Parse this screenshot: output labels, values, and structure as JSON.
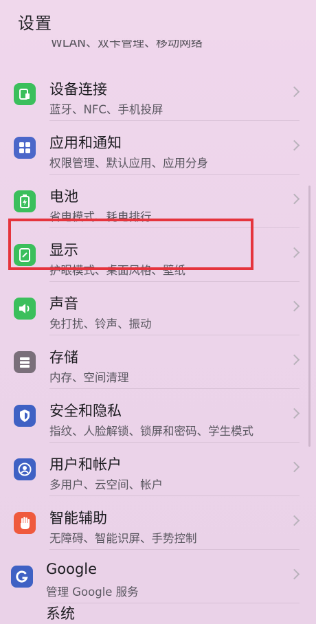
{
  "header": {
    "title": "设置",
    "clipped_item_subtitle": "WLAN、双卡管理、移动网络"
  },
  "items": [
    {
      "title": "设备连接",
      "subtitle": "蓝牙、NFC、手机投屏",
      "icon": "device-connect-icon",
      "color": "#3bbf5c"
    },
    {
      "title": "应用和通知",
      "subtitle": "权限管理、默认应用、应用分身",
      "icon": "apps-grid-icon",
      "color": "#4b67c9"
    },
    {
      "title": "电池",
      "subtitle": "省电模式、耗电排行",
      "icon": "battery-icon",
      "color": "#3bbf5c"
    },
    {
      "title": "显示",
      "subtitle": "护眼模式、桌面风格、壁纸",
      "icon": "display-icon",
      "color": "#3bbf5c"
    },
    {
      "title": "声音",
      "subtitle": "免打扰、铃声、振动",
      "icon": "speaker-icon",
      "color": "#3bbf5c"
    },
    {
      "title": "存储",
      "subtitle": "内存、空间清理",
      "icon": "storage-icon",
      "color": "#7a6f7a"
    },
    {
      "title": "安全和隐私",
      "subtitle": "指纹、人脸解锁、锁屏和密码、学生模式",
      "icon": "shield-icon",
      "color": "#3f61c4"
    },
    {
      "title": "用户和帐户",
      "subtitle": "多用户、云空间、帐户",
      "icon": "user-icon",
      "color": "#3f61c4"
    },
    {
      "title": "智能辅助",
      "subtitle": "无障碍、智能识屏、手势控制",
      "icon": "hand-icon",
      "color": "#ef5a3d"
    },
    {
      "title": "Google",
      "subtitle": "管理 Google 服务",
      "icon": "google-icon",
      "color": "#3f61c4"
    }
  ],
  "bottom_item": {
    "title": "系统"
  },
  "highlight_color": "#e5343d"
}
